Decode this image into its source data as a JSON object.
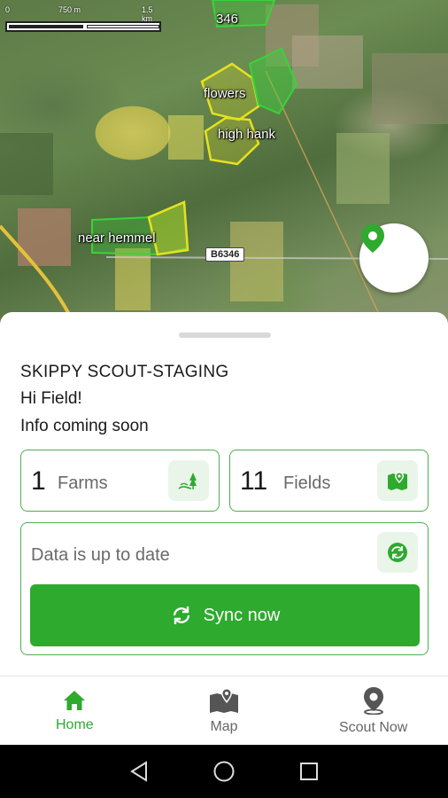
{
  "map": {
    "scale_ticks": [
      "0",
      "750 m",
      "1.5 km"
    ],
    "field_labels": [
      "346",
      "flowers",
      "high hank",
      "near hemmel"
    ],
    "road_label": "B6346"
  },
  "sheet": {
    "org_title": "SKIPPY SCOUT-STAGING",
    "greeting": "Hi Field!",
    "info": "Info coming soon",
    "farms": {
      "count": "1",
      "label": "Farms"
    },
    "fields": {
      "count": "11",
      "label": "Fields"
    },
    "sync_status": "Data is up to date",
    "sync_button_label": "Sync now"
  },
  "bottom_nav": {
    "items": [
      {
        "label": "Home",
        "icon": "home-icon",
        "active": true
      },
      {
        "label": "Map",
        "icon": "map-icon",
        "active": false
      },
      {
        "label": "Scout Now",
        "icon": "location-pin-icon",
        "active": false
      }
    ]
  },
  "colors": {
    "accent": "#2eaa2e",
    "card_border": "#4caf50",
    "icon_tile": "#eaf5e9",
    "field_yellow": "#e8e020",
    "field_green": "#39d339"
  }
}
